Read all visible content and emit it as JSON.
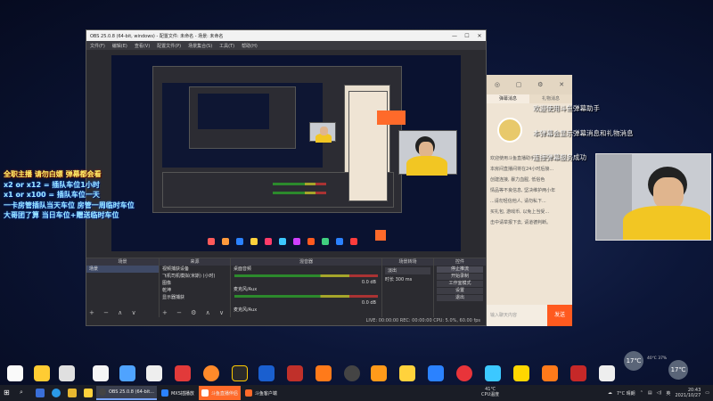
{
  "obs": {
    "title": "OBS 25.0.8 (64-bit, windows) - 配置文件: 未命名 - 场景: 未命名",
    "menu": [
      "文件(F)",
      "编辑(E)",
      "查看(V)",
      "配置文件(P)",
      "场景集合(S)",
      "工具(T)",
      "帮助(H)"
    ],
    "docks": {
      "scenes": {
        "title": "场景",
        "items": [
          "场景"
        ]
      },
      "sources": {
        "title": "来源",
        "items": [
          "视频捕获设备",
          "飞机司机模拟(米斯) (小时)",
          "图像",
          "乾坤",
          "显示器捕获"
        ]
      },
      "mixer": {
        "title": "混音器",
        "channels": [
          {
            "name": "桌面音频",
            "db": "0.0 dB"
          },
          {
            "name": "麦克风/Aux",
            "db": "0.0 dB"
          }
        ],
        "footer": "麦克风/Aux"
      },
      "transitions": {
        "title": "场景转场",
        "type": "淡出",
        "duration_label": "时长",
        "duration": "300 ms"
      },
      "controls": {
        "title": "控件",
        "buttons": [
          "停止推流",
          "开始录制",
          "工作室模式",
          "设置",
          "退出"
        ]
      }
    },
    "status": "LIVE: 00:00:00   REC: 00:00:00   CPU: 5.0%, 60.00 fps"
  },
  "notice": {
    "lines": [
      "全职主播 请勿白嫖 弹幕都会看",
      "x2 or x12 = 插队车位1小时",
      "x1 or x100 = 插队车位一天",
      "一卡房管插队当天车位 房管一周临时车位",
      "大哥团了算 当日车位+赠送临时车位"
    ]
  },
  "douyu": {
    "tabs": [
      "弹幕消息",
      "礼物消息"
    ],
    "lines": [
      "欢迎使用斗鱼直播助手",
      "本房间直播间将在24小时后接...",
      "创建连接, 暴力血腥, 低俗色",
      "情品等不良信息, 坚决维护两小年",
      "...请勿轻信他人, 请勿私下...",
      "买礼包, 游戏币, 以免上当受...",
      "击中请举报下去, 请道德判断。"
    ],
    "input_placeholder": "输入聊天内容",
    "send_label": "发送"
  },
  "welcome": {
    "line1": "欢迎使用斗鱼弹幕助手",
    "line2": "本弹幕会显示弹幕消息和礼物消息",
    "line3": "连接弹幕服务成功"
  },
  "widgets": {
    "left_temp": "17",
    "left_unit": "℃",
    "left_caption": "40℃ 37%",
    "right_temp": "17",
    "right_unit": "℃"
  },
  "taskbar": {
    "apps": [
      {
        "label": "OBS 25.0.8 (64-bit...",
        "active": true
      },
      {
        "label": "MXS插播放"
      },
      {
        "label": "斗鱼直播伴侣",
        "orange": true
      },
      {
        "label": "斗鱼客户端"
      }
    ],
    "cpu_temp": "41℃",
    "cpu_label": "CPU温度",
    "weather": "7°C 晴朗",
    "lang": "英",
    "time": "20:43",
    "date": "2021/10/27"
  },
  "colors": {
    "accent": "#ff5a1f",
    "notice_yellow": "#fff36b",
    "notice_blue": "#9ee8ff"
  }
}
